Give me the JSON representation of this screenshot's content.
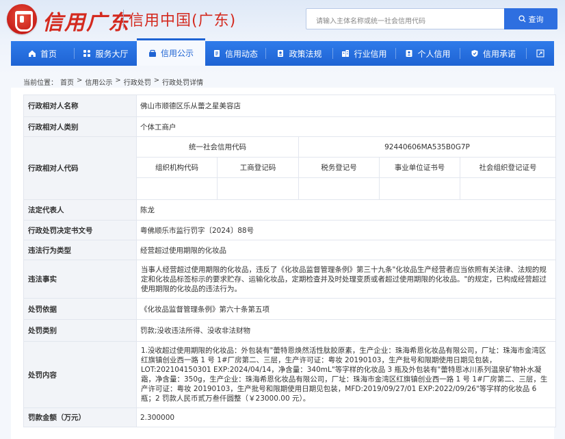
{
  "header": {
    "logo_cursive": "信用广东",
    "logo_text": "信用中国(广东)",
    "search_placeholder": "请输入主体名称或统一社会信用代码",
    "search_button": "查询"
  },
  "nav": {
    "items": [
      {
        "label": "首页",
        "icon": "home-icon"
      },
      {
        "label": "服务大厅",
        "icon": "grid-icon"
      },
      {
        "label": "信用公示",
        "icon": "announce-icon",
        "active": true
      },
      {
        "label": "信用动态",
        "icon": "document-icon"
      },
      {
        "label": "政策法规",
        "icon": "policy-icon"
      },
      {
        "label": "行业信用",
        "icon": "building-icon"
      },
      {
        "label": "个人信用",
        "icon": "id-card-icon"
      },
      {
        "label": "信用承诺",
        "icon": "shield-icon"
      }
    ],
    "expand_icon": "expand-icon"
  },
  "breadcrumb": {
    "prefix": "当前位置：",
    "items": [
      "首页",
      "信用公示",
      "行政处罚",
      "行政处罚详情"
    ],
    "separator": ">"
  },
  "record": {
    "counterpart_name_label": "行政相对人名称",
    "counterpart_name": "佛山市顺德区乐从蕾之星美容店",
    "counterpart_type_label": "行政相对人类别",
    "counterpart_type": "个体工商户",
    "code_label": "行政相对人代码",
    "uscc_label": "统一社会信用代码",
    "uscc": "92440606MA535B0G7P",
    "sub_codes": [
      "组织机构代码",
      "工商登记码",
      "税务登记号",
      "事业单位证书号",
      "社会组织登记证号"
    ],
    "legal_rep_label": "法定代表人",
    "legal_rep": "陈龙",
    "decision_no_label": "行政处罚决定书文号",
    "decision_no": "粤佛顺乐市监行罚字〔2024〕88号",
    "violation_type_label": "违法行为类型",
    "violation_type": "经营超过使用期限的化妆品",
    "facts_label": "违法事实",
    "facts": "当事人经营超过使用期限的化妆品，违反了《化妆品监督管理条例》第三十九条\"化妆品生产经营者应当依照有关法律、法规的规定和化妆品标签标示的要求贮存、运输化妆品，定期检查并及时处理变质或者超过使用期限的化妆品。\"的规定，已构成经营超过使用期限的化妆品的违法行为。",
    "basis_label": "处罚依据",
    "basis": "《化妆品监督管理条例》第六十条第五项",
    "category_label": "处罚类别",
    "category": "罚款;没收违法所得、没收非法财物",
    "content_label": "处罚内容",
    "content": "1.没收超过使用期限的化妆品：外包装有\"蕾特恩焕然活性肽胶原素，生产企业：珠海希恩化妆品有限公司，厂址：珠海市金湾区红旗镇创业西一路 1 号 1#厂房第二、三层，生产许可证：粤妆 20190103，生产批号和限期使用日期见包装，LOT:202104150301 EXP:2024/04/14，净含量：340mL\"等字样的化妆品 3 瓶及外包装有\"蕾特恩冰川系列温泉矿物补水凝霜，净含量：350g，生产企业：珠海希恩化妆品有限公司，厂址：珠海市金湾区红旗镇创业西一路 1 号 1#厂房第二、三层，生产许可证：粤妆 20190103，生产批号和限期使用日期见包装，MFD:2019/09/27/01 EXP:2022/09/26\"等字样的化妆品 6 瓶；2 罚款人民币贰万叁仟圆整（￥23000.00 元）。",
    "fine_label": "罚款金额（万元）",
    "fine": "2.300000"
  },
  "colors": {
    "nav_blue": "#1e63d3",
    "logo_red": "#d42a1f",
    "label_bg": "#f2f4f8"
  }
}
